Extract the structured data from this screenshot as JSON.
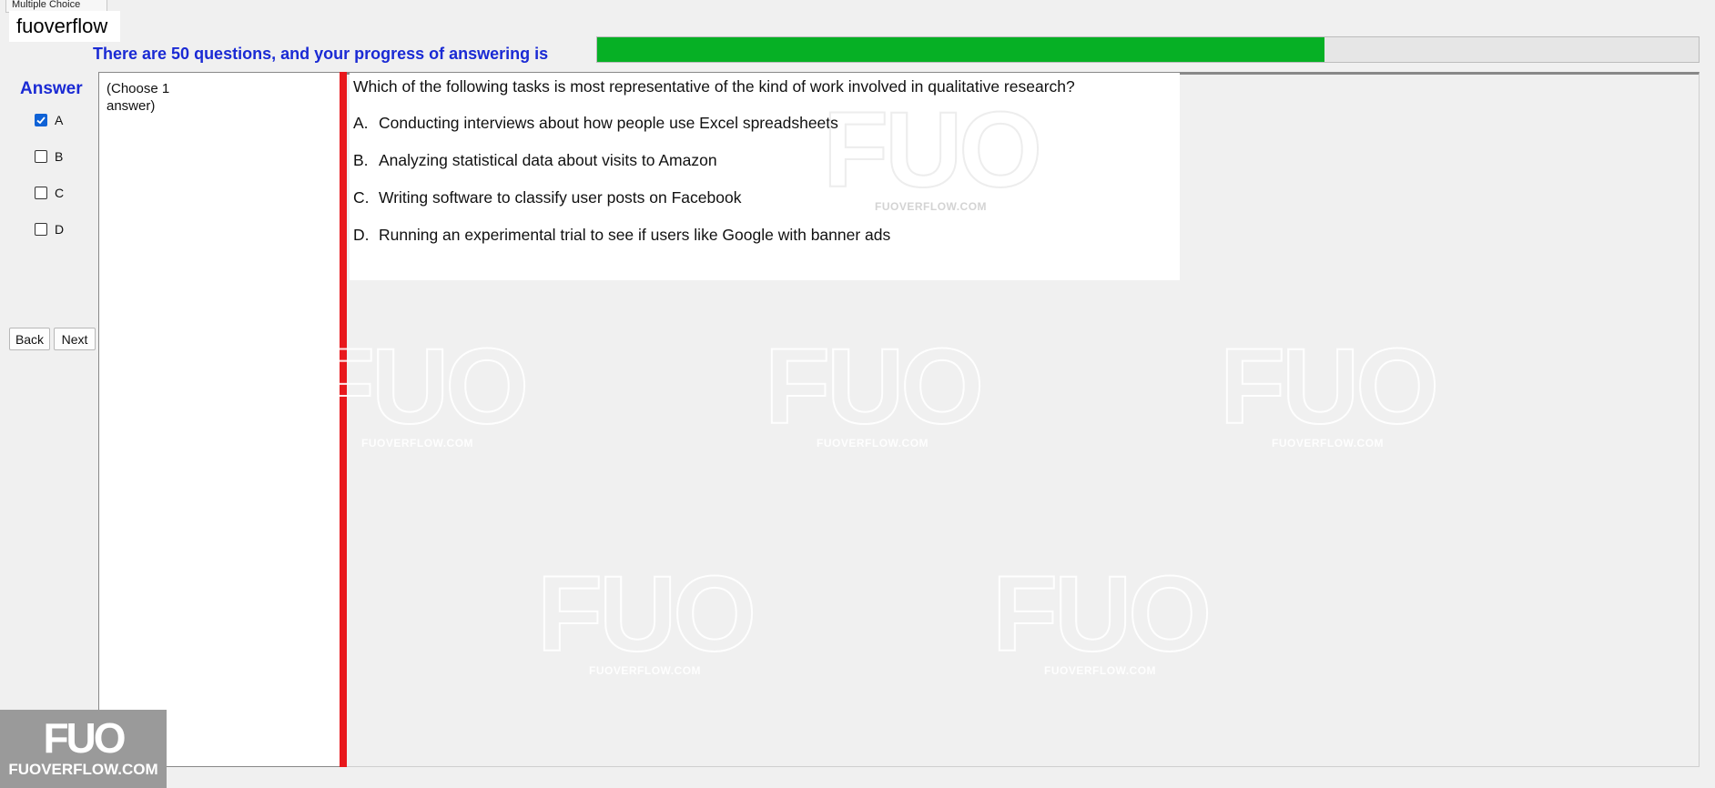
{
  "window": {
    "tab_label": "Multiple Choice"
  },
  "app_title": "fuoverflow",
  "progress": {
    "label": "There are 50 questions, and your progress of answering is",
    "value": 0.66,
    "fill_color": "#06b025"
  },
  "answer_panel": {
    "title": "Answer",
    "options": [
      {
        "label": "A",
        "checked": true
      },
      {
        "label": "B",
        "checked": false
      },
      {
        "label": "C",
        "checked": false
      },
      {
        "label": "D",
        "checked": false
      }
    ]
  },
  "nav": {
    "back_label": "Back",
    "next_label": "Next"
  },
  "instruction": "(Choose 1 answer)",
  "question": {
    "text": "Which of the following tasks is most representative of the kind of work involved in qualitative research?",
    "options": [
      {
        "letter": "A.",
        "text": "Conducting interviews about how people use Excel spreadsheets"
      },
      {
        "letter": "B.",
        "text": "Analyzing statistical data about visits to Amazon"
      },
      {
        "letter": "C.",
        "text": "Writing software to classify user posts on Facebook"
      },
      {
        "letter": "D.",
        "text": "Running an experimental trial to see if users like Google with banner ads"
      }
    ]
  },
  "watermark": {
    "mark": "FUO",
    "site": "FUOVERFLOW.COM"
  },
  "colors": {
    "accent_text": "#1a2ad4",
    "divider_red": "#e8181c",
    "checkbox_checked": "#0f62d6"
  }
}
